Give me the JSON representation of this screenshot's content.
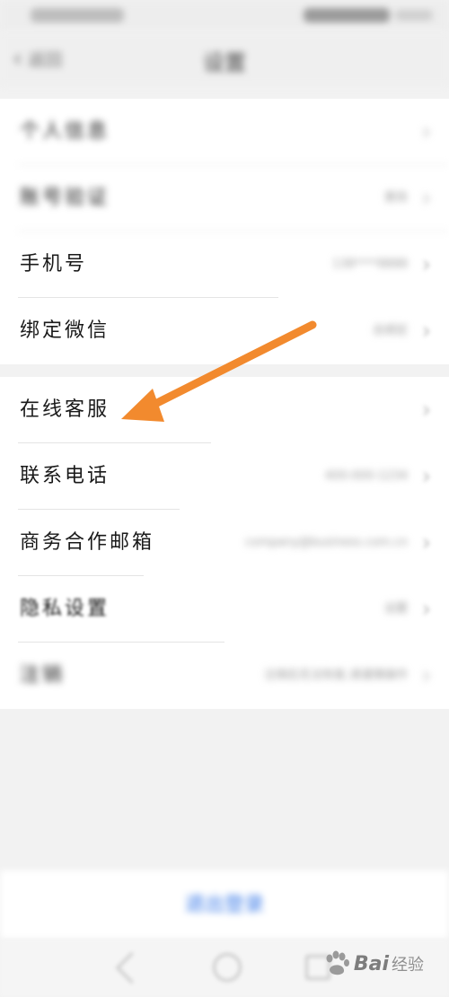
{
  "status_bar": {},
  "nav": {
    "back_label": "返回",
    "title": "设置"
  },
  "section1": {
    "rows": [
      {
        "label": "个人信息",
        "value": ""
      },
      {
        "label": "账号验证",
        "value": "更改"
      },
      {
        "label": "手机号",
        "value": "138****8888"
      },
      {
        "label": "绑定微信",
        "value": "去绑定"
      }
    ]
  },
  "section2": {
    "rows": [
      {
        "label": "在线客服",
        "value": ""
      },
      {
        "label": "联系电话",
        "value": "400-000-1234"
      },
      {
        "label": "商务合作邮箱",
        "value": "company@business.com.cn"
      },
      {
        "label": "隐私设置",
        "value": "设置"
      },
      {
        "label": "注销",
        "value": "注销后无法恢复,请谨慎操作"
      }
    ]
  },
  "bottom": {
    "logout_label": "退出登录"
  },
  "watermark": {
    "brand": "Bai",
    "suffix": "经验"
  },
  "colors": {
    "accent": "#3b7be8",
    "annotation_arrow": "#f28a2e",
    "page_bg": "#f2f2f2"
  },
  "icons": {
    "back": "chevron-left-icon",
    "row_chevron": "chevron-right-icon",
    "annotation": "arrow-annotation-icon",
    "watermark_paw": "paw-icon"
  }
}
